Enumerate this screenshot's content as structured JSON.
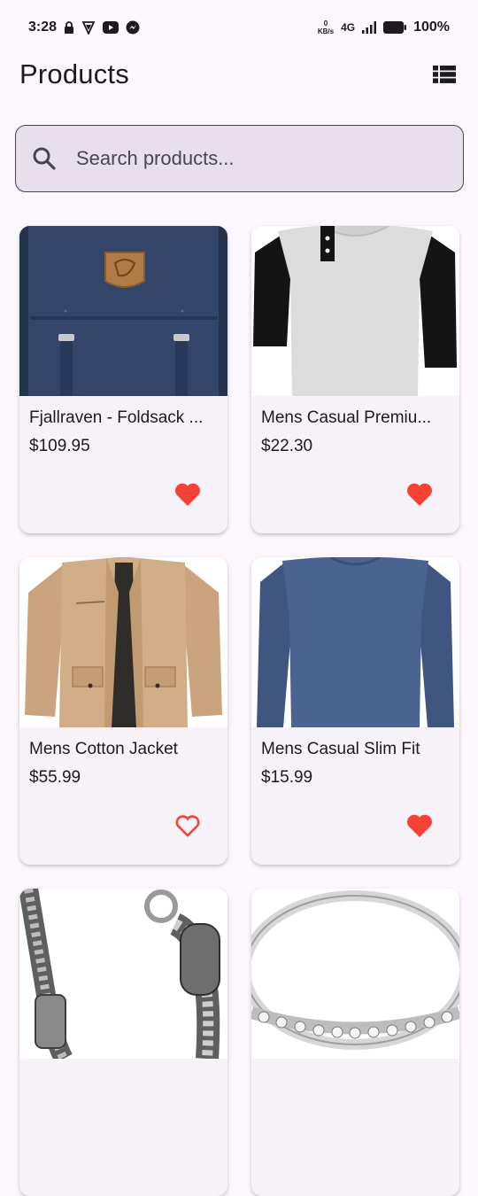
{
  "status_bar": {
    "time": "3:28",
    "net_speed_value": "0",
    "net_speed_unit": "KB/s",
    "net_type": "4G",
    "battery": "100%"
  },
  "header": {
    "title": "Products"
  },
  "search": {
    "placeholder": "Search products..."
  },
  "products": [
    {
      "title": "Fjallraven - Foldsack ...",
      "price": "$109.95",
      "favorite": true,
      "image": "backpack"
    },
    {
      "title": "Mens Casual Premiu...",
      "price": "$22.30",
      "favorite": true,
      "image": "raglan-tshirt"
    },
    {
      "title": "Mens Cotton Jacket",
      "price": "$55.99",
      "favorite": false,
      "image": "cotton-jacket"
    },
    {
      "title": "Mens Casual Slim Fit",
      "price": "$15.99",
      "favorite": true,
      "image": "longsleeve-shirt"
    },
    {
      "title": "",
      "price": "",
      "favorite": false,
      "image": "silver-bracelet"
    },
    {
      "title": "",
      "price": "",
      "favorite": false,
      "image": "diamond-ring"
    }
  ],
  "colors": {
    "background": "#fcf6fd",
    "card": "#f7f2f8",
    "search_fill": "#e7e0ec",
    "favorite": "#f44336"
  }
}
